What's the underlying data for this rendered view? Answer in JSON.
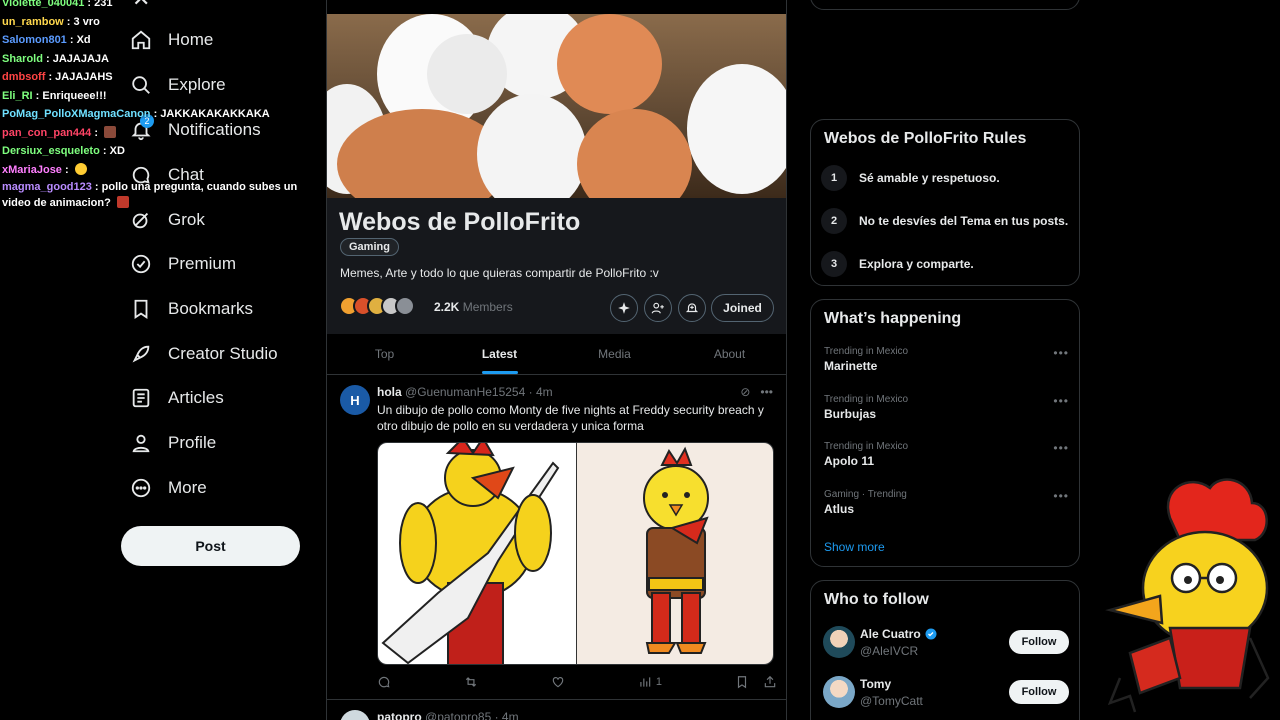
{
  "chat": [
    {
      "user": "Violette_040041",
      "color": "#7fff7f",
      "msg": "231"
    },
    {
      "user": "un_rambow",
      "color": "#ffd84d",
      "msg": "3 vro"
    },
    {
      "user": "Salomon801",
      "color": "#5b9bff",
      "msg": "Xd"
    },
    {
      "user": "Sharold",
      "color": "#7fff7f",
      "msg": "JAJAJAJA"
    },
    {
      "user": "dmbsoff",
      "color": "#ff4444",
      "msg": "JAJAJAHS"
    },
    {
      "user": "Eli_RI",
      "color": "#7fff7f",
      "msg": "Enriqueee!!!"
    },
    {
      "user": "PoMag_PolloXMagmaCanon",
      "color": "#6fe0ff",
      "msg": "JAKKAKAKAKKAKA"
    },
    {
      "user": "pan_con_pan444",
      "color": "#ff4466",
      "msg": ""
    },
    {
      "user": "Dersiux_esqueleto",
      "color": "#7fff7f",
      "msg": "XD"
    },
    {
      "user": "xMariaJose",
      "color": "#ff7fff",
      "msg": ""
    },
    {
      "user": "magma_good123",
      "color": "#b98cff",
      "msg": "pollo una pregunta, cuando subes un video de animacion?"
    }
  ],
  "nav": {
    "home": "Home",
    "explore": "Explore",
    "notifications": "Notifications",
    "notif_badge": "2",
    "chat": "Chat",
    "grok": "Grok",
    "premium": "Premium",
    "bookmarks": "Bookmarks",
    "creator_studio": "Creator Studio",
    "articles": "Articles",
    "profile": "Profile",
    "more": "More",
    "post": "Post"
  },
  "community": {
    "title": "Webos de PolloFrito",
    "tag": "Gaming",
    "description": "Memes, Arte y todo lo que quieras compartir de PolloFrito :v",
    "members_count": "2.2K",
    "members_label": "Members",
    "joined": "Joined"
  },
  "tabs": [
    "Top",
    "Latest",
    "Media",
    "About"
  ],
  "active_tab": "Latest",
  "tweet": {
    "avatar_letter": "H",
    "name": "hola",
    "handle": "@GuenumanHe15254 · 4m",
    "text": "Un dibujo de pollo como Monty de five nights at Freddy security breach y otro dibujo de pollo en su verdadera y unica forma",
    "views": "1"
  },
  "tweet2": {
    "name": "patopro",
    "handle": "@patopro85 · 4m"
  },
  "rules": {
    "title": "Webos de PolloFrito Rules",
    "items": [
      {
        "num": "1",
        "text": "Sé amable y respetuoso."
      },
      {
        "num": "2",
        "text": "No te desvíes del Tema en tus posts."
      },
      {
        "num": "3",
        "text": "Explora y comparte."
      }
    ]
  },
  "happening": {
    "title": "What’s happening",
    "trends": [
      {
        "meta": "Trending in Mexico",
        "name": "Marinette"
      },
      {
        "meta": "Trending in Mexico",
        "name": "Burbujas"
      },
      {
        "meta": "Trending in Mexico",
        "name": "Apolo 11"
      },
      {
        "meta": "Gaming · Trending",
        "name": "Atlus"
      }
    ],
    "show_more": "Show more"
  },
  "who_to_follow": {
    "title": "Who to follow",
    "users": [
      {
        "name": "Ale Cuatro",
        "handle": "@AleIVCR",
        "verified": true,
        "follow": "Follow"
      },
      {
        "name": "Tomy",
        "handle": "@TomyCatt",
        "verified": false,
        "follow": "Follow"
      }
    ]
  },
  "colors": {
    "accent": "#1d9bf0",
    "background": "#000000",
    "border": "#2f3336",
    "muted": "#71767b"
  }
}
